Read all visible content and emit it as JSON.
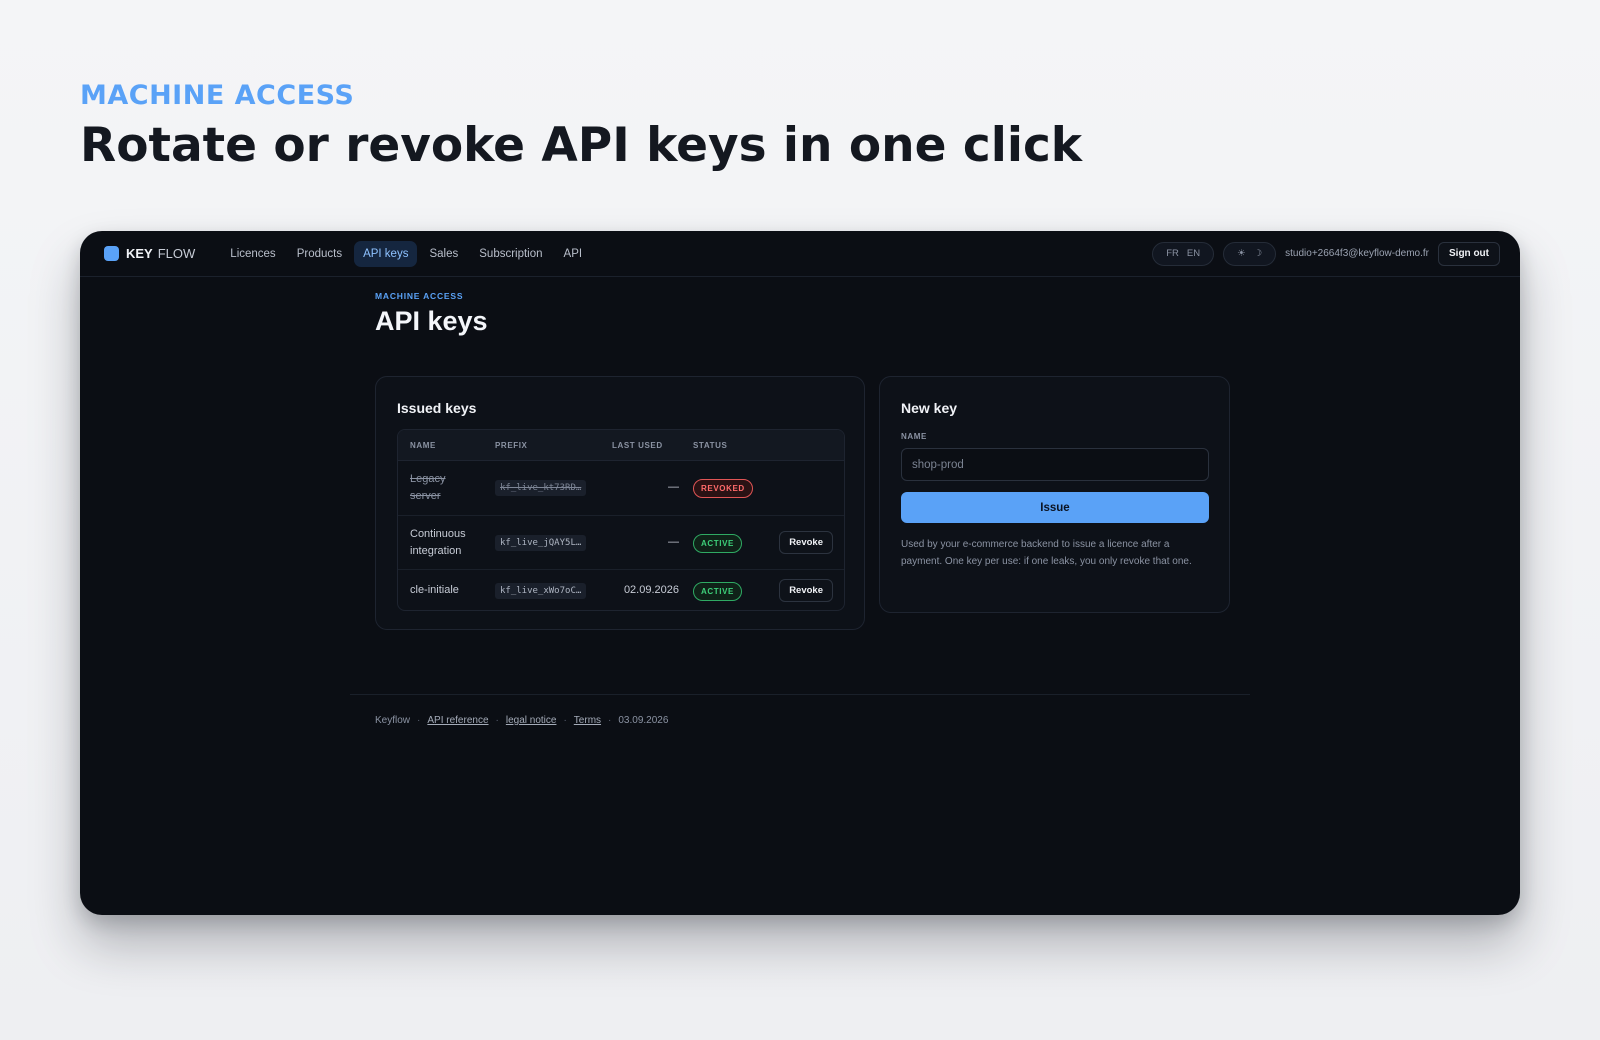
{
  "hero": {
    "eyebrow": "MACHINE ACCESS",
    "title": "Rotate or revoke API keys in one click"
  },
  "navbar": {
    "logo_key": "KEY",
    "logo_flow": "FLOW",
    "items": [
      {
        "label": "Licences",
        "active": false
      },
      {
        "label": "Products",
        "active": false
      },
      {
        "label": "API keys",
        "active": true
      },
      {
        "label": "Sales",
        "active": false
      },
      {
        "label": "Subscription",
        "active": false
      },
      {
        "label": "API",
        "active": false
      }
    ],
    "lang": [
      "FR",
      "EN"
    ],
    "theme_light_icon": "sun-icon",
    "theme_dark_icon": "moon-icon",
    "theme_light_glyph": "☀",
    "theme_dark_glyph": "☽",
    "user_email": "studio+2664f3@keyflow-demo.fr",
    "sign_out": "Sign out"
  },
  "page": {
    "eyebrow": "MACHINE ACCESS",
    "title": "API keys"
  },
  "issued_keys": {
    "title": "Issued keys",
    "columns": [
      "NAME",
      "PREFIX",
      "LAST USED",
      "STATUS"
    ],
    "rows": [
      {
        "name_line1": "Legacy",
        "name_line2": "server",
        "prefix": "kf_live_kt73RD…",
        "last_used": "—",
        "status": "REVOKED",
        "action": ""
      },
      {
        "name_line1": "Continuous",
        "name_line2": "integration",
        "prefix": "kf_live_jQAY5L…",
        "last_used": "—",
        "status": "ACTIVE",
        "action": "Revoke"
      },
      {
        "name_line1": "cle-initiale",
        "name_line2": "",
        "prefix": "kf_live_xWo7oC…",
        "last_used": "02.09.2026",
        "status": "ACTIVE",
        "action": "Revoke"
      }
    ]
  },
  "new_key": {
    "title": "New key",
    "name_label": "NAME",
    "name_placeholder": "shop-prod",
    "issue_label": "Issue",
    "helper": "Used by your e-commerce backend to issue a licence after a payment. One key per use: if one leaks, you only revoke that one."
  },
  "footer": {
    "brand": "Keyflow",
    "api_reference": "API reference",
    "legal_notice": "legal notice",
    "terms": "Terms",
    "date": "03.09.2026"
  },
  "colors": {
    "accent": "#5aa2f7",
    "background": "#0b0e14",
    "revoked": "#ff6b6b",
    "active": "#3ed07a"
  }
}
